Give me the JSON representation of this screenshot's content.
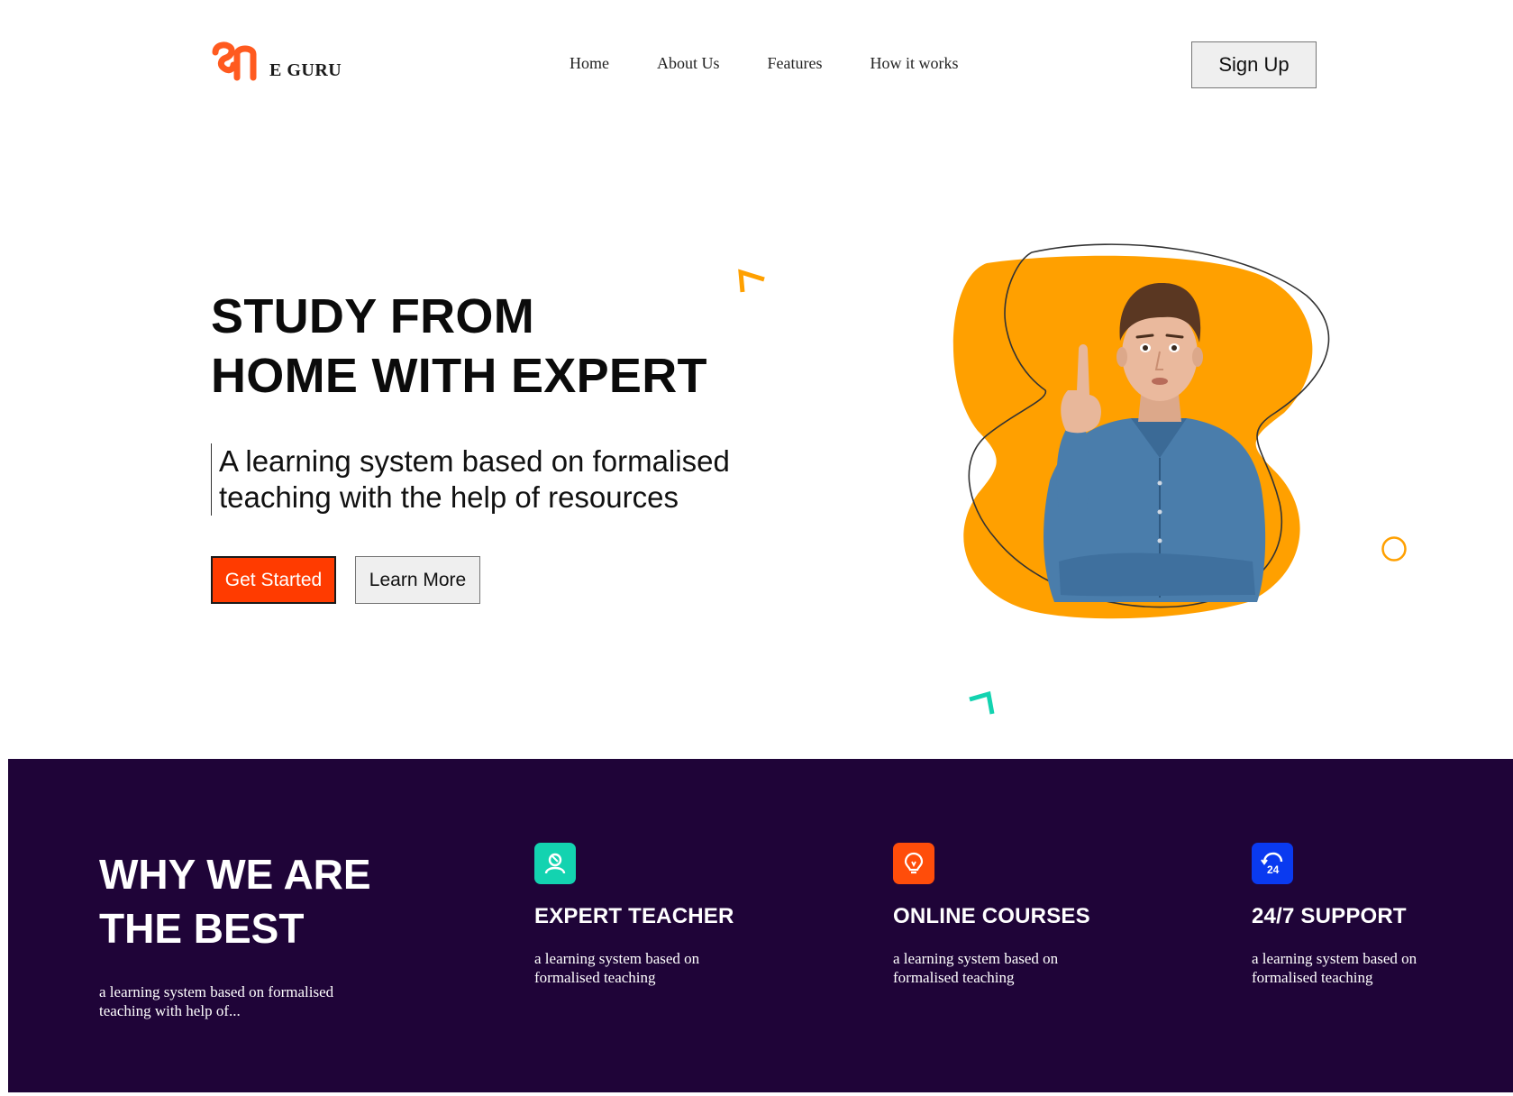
{
  "header": {
    "brand": "E GURU",
    "nav": [
      {
        "label": "Home"
      },
      {
        "label": "About Us"
      },
      {
        "label": "Features"
      },
      {
        "label": "How it works"
      }
    ],
    "signup_label": "Sign Up"
  },
  "hero": {
    "title_lines": [
      "STUDY FROM",
      "HOME WITH EXPERT"
    ],
    "subtitle_lines": [
      "A learning system based on formalised",
      "teaching with the help of resources"
    ],
    "primary_button": "Get Started",
    "secondary_button": "Learn More",
    "image_icon": "man-pointing-up-photo"
  },
  "why": {
    "title_lines": [
      "WHY WE ARE",
      "THE BEST"
    ],
    "text": "a learning system based on formalised teaching with help of...",
    "features": [
      {
        "icon": "teacher-icon",
        "title": "EXPERT TEACHER",
        "text": "a learning system based on formalised teaching",
        "color": "#13d3b0"
      },
      {
        "icon": "lightbulb-icon",
        "title": "ONLINE COURSES",
        "text": "a learning system based on formalised teaching",
        "color": "#ff4d0a"
      },
      {
        "icon": "support-24-icon",
        "title": "24/7 SUPPORT",
        "text": "a learning system based on formalised teaching",
        "color": "#0a3af0"
      }
    ]
  },
  "colors": {
    "brand_orange": "#ff5a1f",
    "accent_orange": "#ffa000",
    "accent_teal": "#13d3b0",
    "band_bg": "#1f0438",
    "cta_red": "#ff3b00"
  }
}
